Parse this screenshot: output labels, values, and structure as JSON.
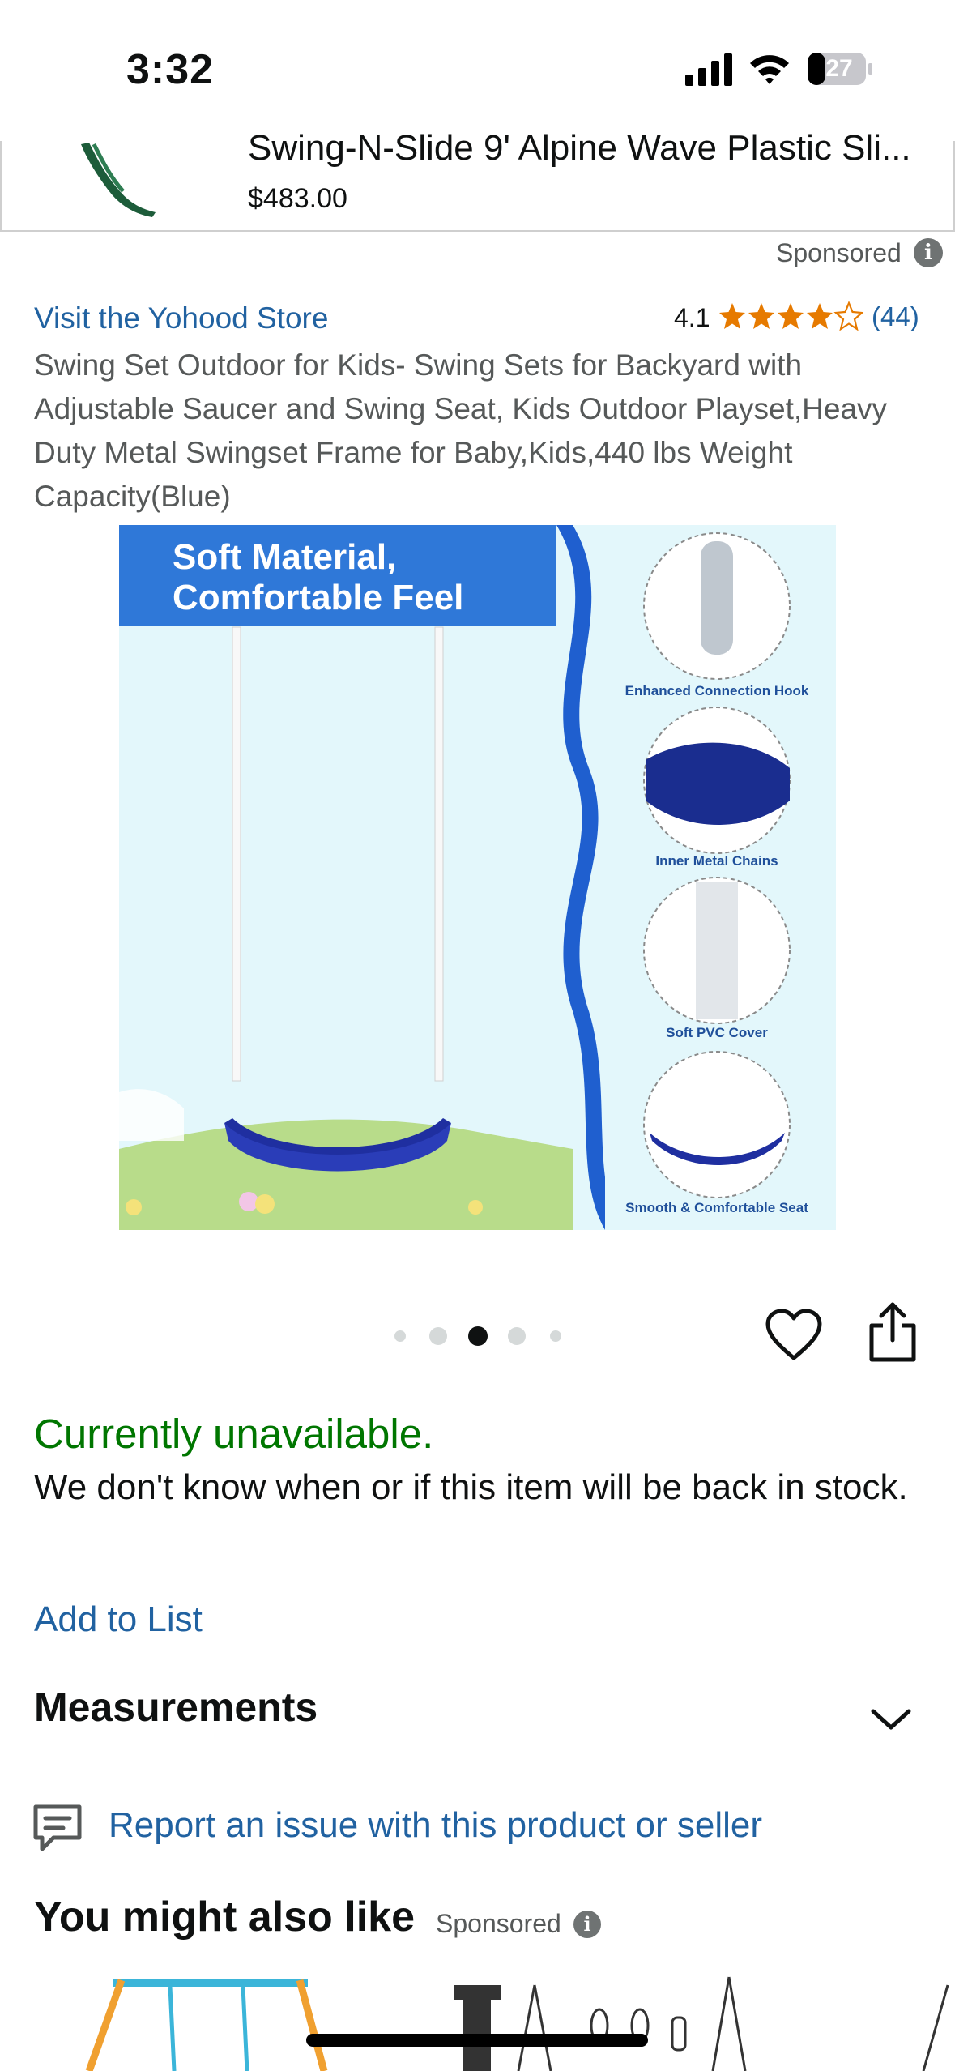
{
  "status_bar": {
    "time": "3:32",
    "battery": "27"
  },
  "banner": {
    "title": "Swing-N-Slide 9' Alpine Wave Plastic Sli...",
    "price": "$483.00",
    "sponsored": "Sponsored"
  },
  "store": {
    "link": "Visit the Yohood Store"
  },
  "rating": {
    "value": "4.1",
    "stars": 4.1,
    "count": "(44)"
  },
  "product": {
    "title": "Swing Set Outdoor for Kids- Swing Sets for Backyard with Adjustable Saucer and Swing Seat, Kids Outdoor Playset,Heavy Duty Metal Swingset Frame for Baby,Kids,440 lbs Weight Capacity(Blue)"
  },
  "image": {
    "headline_line1": "Soft Material,",
    "headline_line2": "Comfortable Feel",
    "callouts": [
      "Enhanced Connection Hook",
      "Inner Metal Chains",
      "Soft PVC Cover",
      "Smooth & Comfortable Seat"
    ]
  },
  "carousel": {
    "active_index": 2,
    "count": 5
  },
  "availability": {
    "status": "Currently unavailable.",
    "message": "We don't know when or if this item will be back in stock."
  },
  "actions": {
    "add_to_list": "Add to List",
    "measurements": "Measurements",
    "report": "Report an issue with this product or seller"
  },
  "recommendations": {
    "title": "You might also like",
    "sponsored": "Sponsored"
  },
  "colors": {
    "link": "#2162a1",
    "available_green": "#007600",
    "star": "#e67a00",
    "text": "#0f1111",
    "muted": "#565959"
  }
}
